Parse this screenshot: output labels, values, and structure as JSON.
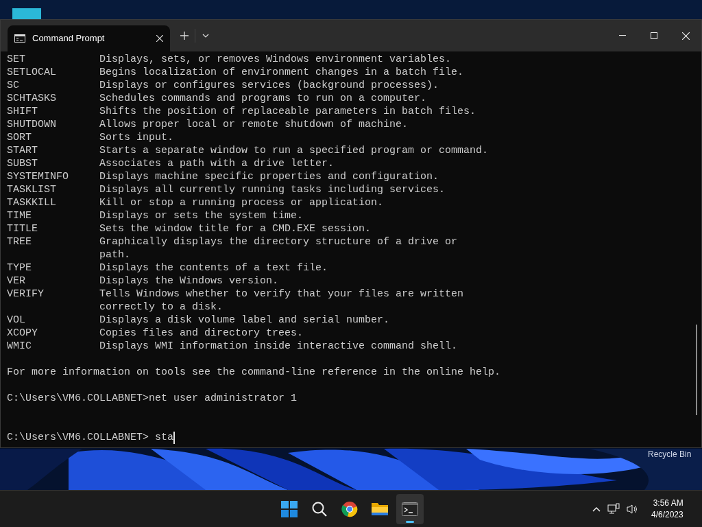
{
  "desktop": {
    "icon_label": "Recycle Bin"
  },
  "window": {
    "tabs": [
      {
        "title": "Command Prompt",
        "selected": true
      }
    ],
    "terminal": {
      "lines": [
        {
          "kind": "help",
          "command": "SET",
          "description": [
            "Displays, sets, or removes Windows environment variables."
          ]
        },
        {
          "kind": "help",
          "command": "SETLOCAL",
          "description": [
            "Begins localization of environment changes in a batch file."
          ]
        },
        {
          "kind": "help",
          "command": "SC",
          "description": [
            "Displays or configures services (background processes)."
          ]
        },
        {
          "kind": "help",
          "command": "SCHTASKS",
          "description": [
            "Schedules commands and programs to run on a computer."
          ]
        },
        {
          "kind": "help",
          "command": "SHIFT",
          "description": [
            "Shifts the position of replaceable parameters in batch files."
          ]
        },
        {
          "kind": "help",
          "command": "SHUTDOWN",
          "description": [
            "Allows proper local or remote shutdown of machine."
          ]
        },
        {
          "kind": "help",
          "command": "SORT",
          "description": [
            "Sorts input."
          ]
        },
        {
          "kind": "help",
          "command": "START",
          "description": [
            "Starts a separate window to run a specified program or command."
          ]
        },
        {
          "kind": "help",
          "command": "SUBST",
          "description": [
            "Associates a path with a drive letter."
          ]
        },
        {
          "kind": "help",
          "command": "SYSTEMINFO",
          "description": [
            "Displays machine specific properties and configuration."
          ]
        },
        {
          "kind": "help",
          "command": "TASKLIST",
          "description": [
            "Displays all currently running tasks including services."
          ]
        },
        {
          "kind": "help",
          "command": "TASKKILL",
          "description": [
            "Kill or stop a running process or application."
          ]
        },
        {
          "kind": "help",
          "command": "TIME",
          "description": [
            "Displays or sets the system time."
          ]
        },
        {
          "kind": "help",
          "command": "TITLE",
          "description": [
            "Sets the window title for a CMD.EXE session."
          ]
        },
        {
          "kind": "help",
          "command": "TREE",
          "description": [
            "Graphically displays the directory structure of a drive or",
            "path."
          ]
        },
        {
          "kind": "help",
          "command": "TYPE",
          "description": [
            "Displays the contents of a text file."
          ]
        },
        {
          "kind": "help",
          "command": "VER",
          "description": [
            "Displays the Windows version."
          ]
        },
        {
          "kind": "help",
          "command": "VERIFY",
          "description": [
            "Tells Windows whether to verify that your files are written",
            "correctly to a disk."
          ]
        },
        {
          "kind": "help",
          "command": "VOL",
          "description": [
            "Displays a disk volume label and serial number."
          ]
        },
        {
          "kind": "help",
          "command": "XCOPY",
          "description": [
            "Copies files and directory trees."
          ]
        },
        {
          "kind": "help",
          "command": "WMIC",
          "description": [
            "Displays WMI information inside interactive command shell."
          ]
        },
        {
          "kind": "blank"
        },
        {
          "kind": "text",
          "text": "For more information on tools see the command-line reference in the online help."
        },
        {
          "kind": "blank"
        },
        {
          "kind": "prompt",
          "text": "C:\\Users\\VM6.COLLABNET>net user administrator 1",
          "cursor": false
        },
        {
          "kind": "blank"
        },
        {
          "kind": "blank"
        },
        {
          "kind": "prompt",
          "text": "C:\\Users\\VM6.COLLABNET> sta",
          "cursor": true
        }
      ]
    }
  },
  "taskbar": {
    "apps": [
      {
        "kind": "start",
        "active": false
      },
      {
        "kind": "search",
        "active": false
      },
      {
        "kind": "browser",
        "active": false
      },
      {
        "kind": "folder",
        "active": false
      },
      {
        "kind": "terminal",
        "active": true
      }
    ],
    "clock": {
      "time": "3:56 AM",
      "date": "4/6/2023"
    }
  }
}
